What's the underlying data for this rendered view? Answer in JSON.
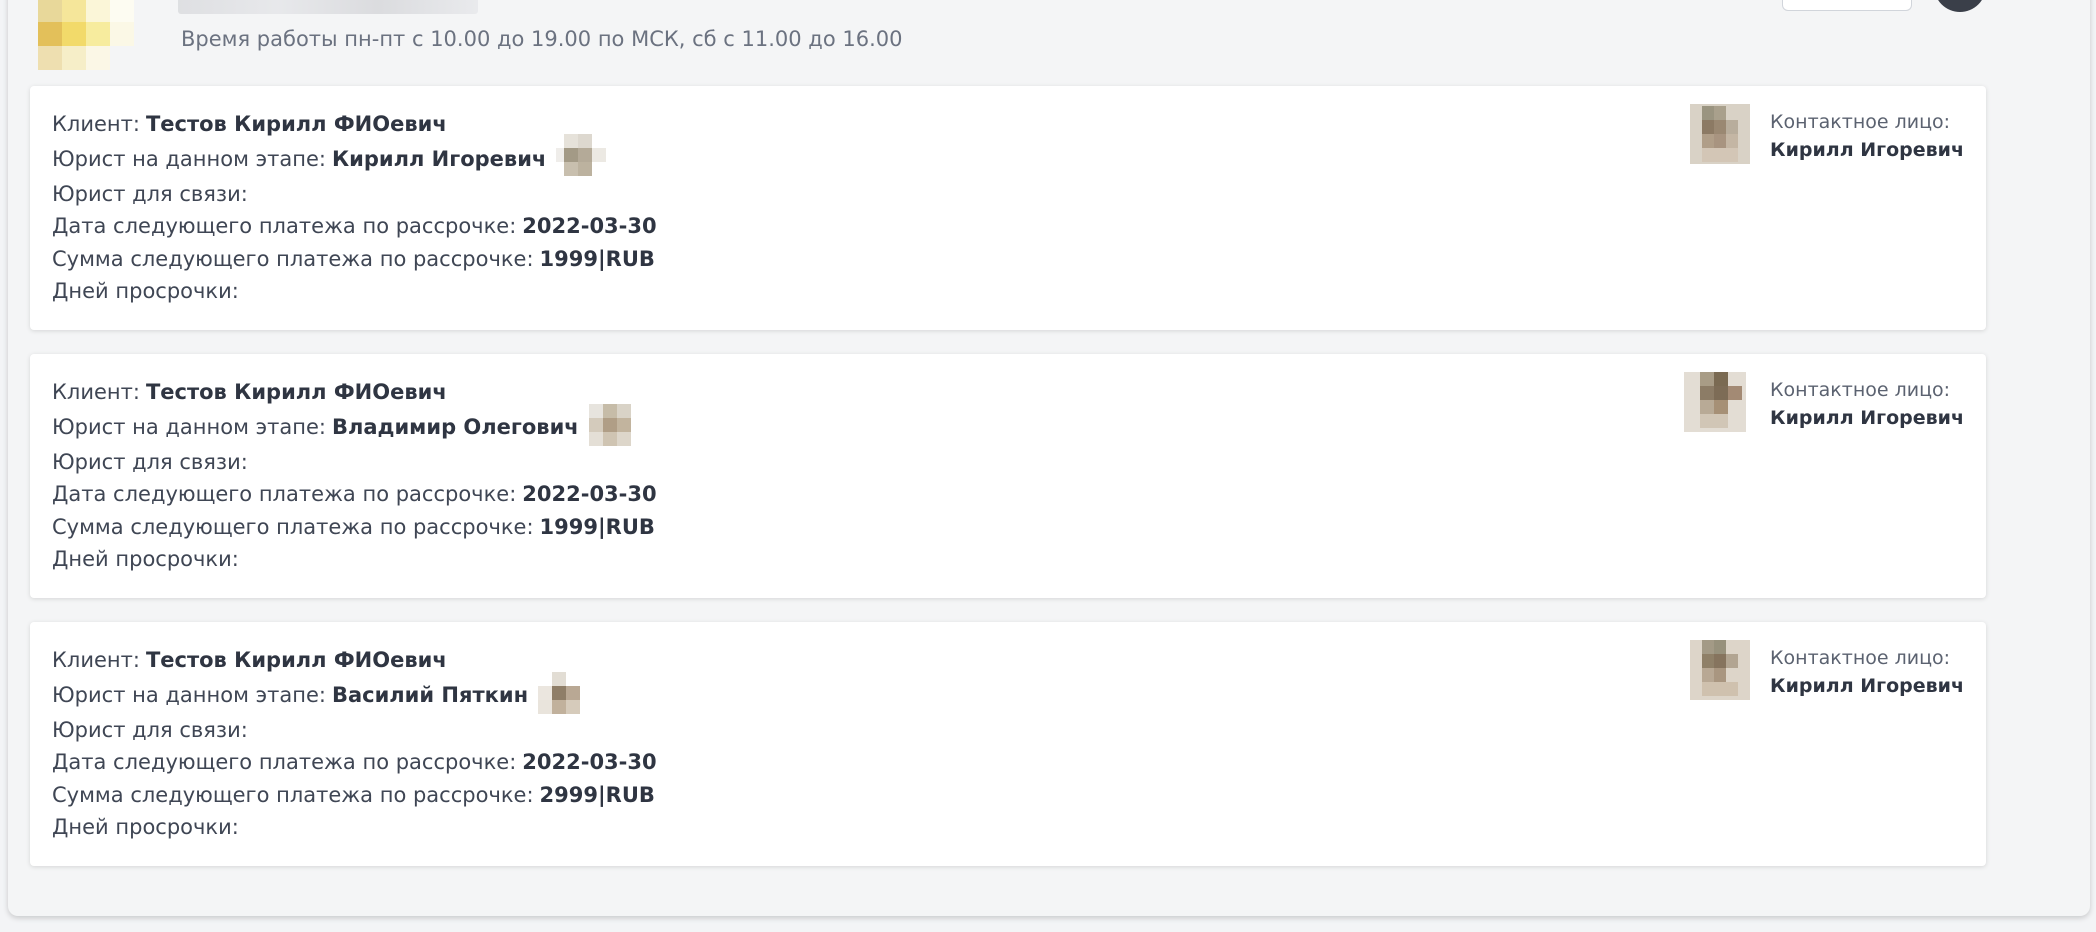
{
  "header": {
    "work_hours": "Время работы пн-пт с 10.00 до 19.00 по МСК, сб с 11.00 до 16.00"
  },
  "labels": {
    "client": "Клиент:",
    "stage_lawyer": "Юрист на данном этапе:",
    "contact_lawyer": "Юрист для связи:",
    "next_payment_date": "Дата следующего платежа по рассрочке:",
    "next_payment_sum": "Сумма следующего платежа по рассрочке:",
    "overdue_days": "Дней просрочки:",
    "contact_person": "Контактное лицо:"
  },
  "cards": [
    {
      "client": "Тестов Кирилл ФИОевич",
      "stage_lawyer": "Кирилл Игоревич",
      "contact_lawyer": "",
      "next_payment_date": "2022-03-30",
      "next_payment_sum": "1999|RUB",
      "overdue_days": "",
      "contact_person": "Кирилл Игоревич"
    },
    {
      "client": "Тестов Кирилл ФИОевич",
      "stage_lawyer": "Владимир Олегович",
      "contact_lawyer": "",
      "next_payment_date": "2022-03-30",
      "next_payment_sum": "1999|RUB",
      "overdue_days": "",
      "contact_person": "Кирилл Игоревич"
    },
    {
      "client": "Тестов Кирилл ФИОевич",
      "stage_lawyer": "Василий Пяткин",
      "contact_lawyer": "",
      "next_payment_date": "2022-03-30",
      "next_payment_sum": "2999|RUB",
      "overdue_days": "",
      "contact_person": "Кирилл Игоревич"
    }
  ]
}
